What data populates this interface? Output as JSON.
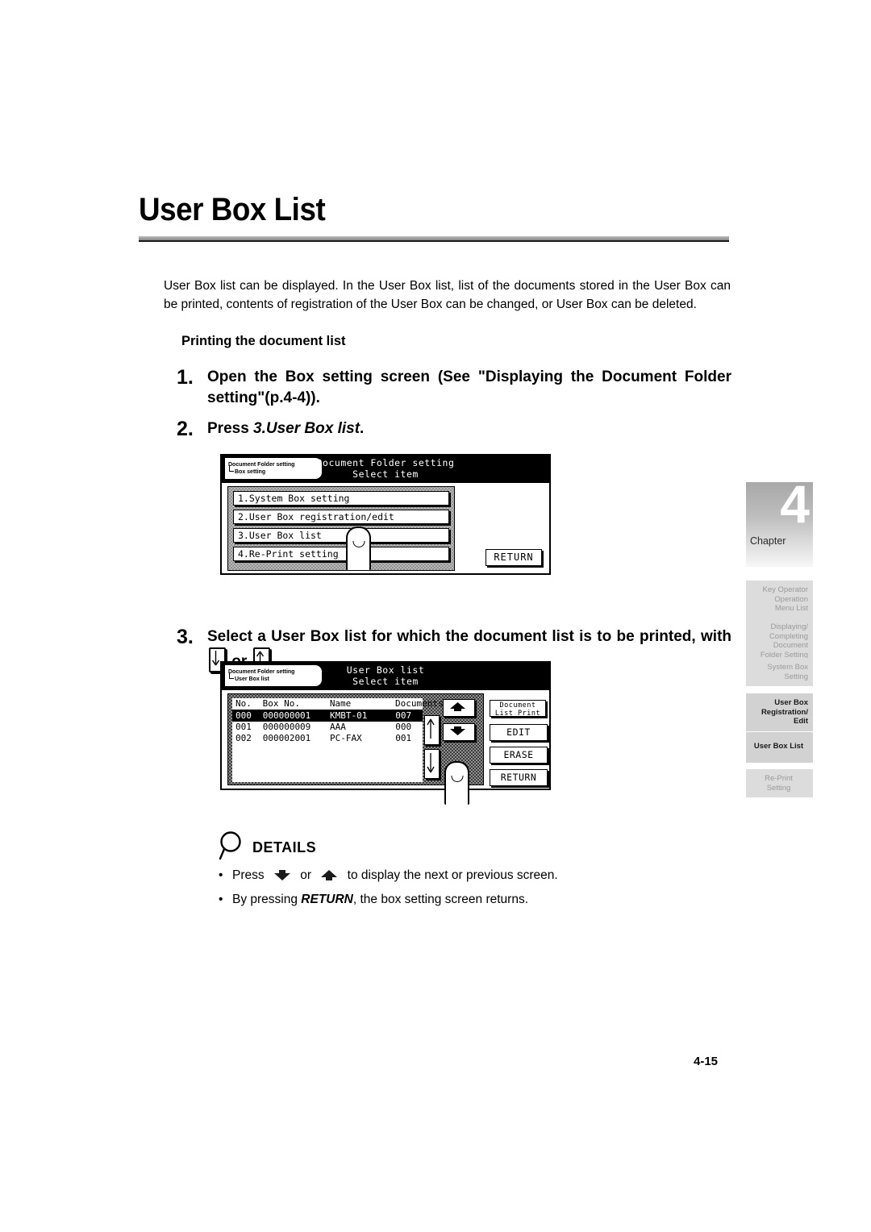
{
  "page": {
    "title": "User Box List",
    "number": "4-15"
  },
  "intro": "User Box list can be displayed. In the User Box list, list of the documents stored in the User Box can be printed, contents of registration of the User Box can be changed, or User Box can be deleted.",
  "subhead": "Printing the document list",
  "steps": {
    "one": {
      "num": "1.",
      "text": "Open the Box setting screen (See \"Displaying the Document Folder setting\"(p.4-4))."
    },
    "two": {
      "num": "2.",
      "prefix": "Press ",
      "emphasis": "3.User Box list",
      "suffix": "."
    },
    "three": {
      "num": "3.",
      "text_a": "Select a User Box list for which the document list is to be printed, with ",
      "key_down": "down-arrow-key",
      "text_b": " or ",
      "key_up": "up-arrow-key",
      "text_c": "."
    }
  },
  "lcd1": {
    "breadcrumb_line1": "Document Folder setting",
    "breadcrumb_line2": "Box setting",
    "title": "Document Folder setting",
    "subtitle": "Select item",
    "menu": [
      "1.System Box setting",
      "2.User Box registration/edit",
      "3.User Box list",
      "4.Re-Print setting"
    ],
    "return_label": "RETURN"
  },
  "lcd2": {
    "breadcrumb_line1": "Document Folder setting",
    "breadcrumb_line2": "User Box list",
    "title": "User Box list",
    "subtitle": "Select item",
    "columns": {
      "no": "No.",
      "box_no": "Box No.",
      "name": "Name",
      "documents": "Documents"
    },
    "rows": [
      {
        "no": "000",
        "box_no": "000000001",
        "name": "KMBT-01",
        "documents": "007",
        "selected": true
      },
      {
        "no": "001",
        "box_no": "000000009",
        "name": "AAA",
        "documents": "000",
        "selected": false
      },
      {
        "no": "002",
        "box_no": "000002001",
        "name": "PC-FAX",
        "documents": "001",
        "selected": false
      }
    ],
    "buttons": {
      "doc_list_print_l1": "Document",
      "doc_list_print_l2": "List Print",
      "edit": "EDIT",
      "erase": "ERASE",
      "return": "RETURN"
    }
  },
  "details": {
    "heading": "DETAILS",
    "bullet_char": "•",
    "items": {
      "one_a": "Press ",
      "one_b": " or ",
      "one_c": " to display the next or previous screen.",
      "two_a": "By pressing ",
      "two_em": "RETURN",
      "two_b": ", the box setting screen returns."
    }
  },
  "sidebar": {
    "chapter_label": "Chapter",
    "chapter_number": "4",
    "tabs": [
      {
        "label": "Key Operator Operation Menu List",
        "lines": [
          "Key Operator",
          "Operation",
          "Menu List"
        ],
        "active": false
      },
      {
        "label": "Displaying/Completing Document Folder Setting",
        "lines": [
          "Displaying/",
          "Completing",
          "Document",
          "Folder Setting"
        ],
        "active": false
      },
      {
        "label": "System Box Setting",
        "lines": [
          "System Box",
          "Setting"
        ],
        "active": false
      },
      {
        "label": "User Box Registration/Edit",
        "lines": [
          "User Box",
          "Registration/",
          "Edit"
        ],
        "active": true
      },
      {
        "label": "User Box List",
        "lines": [
          "User Box List"
        ],
        "active": true
      },
      {
        "label": "Re-Print Setting",
        "lines": [
          "Re-Print",
          "Setting"
        ],
        "active": false
      }
    ]
  },
  "colors": {
    "rule": "#9a9a9a",
    "tab_bg": "#dcdcdc",
    "tab_active_text": "#1a1a1a",
    "tab_inactive_text": "#9a9a9a"
  }
}
